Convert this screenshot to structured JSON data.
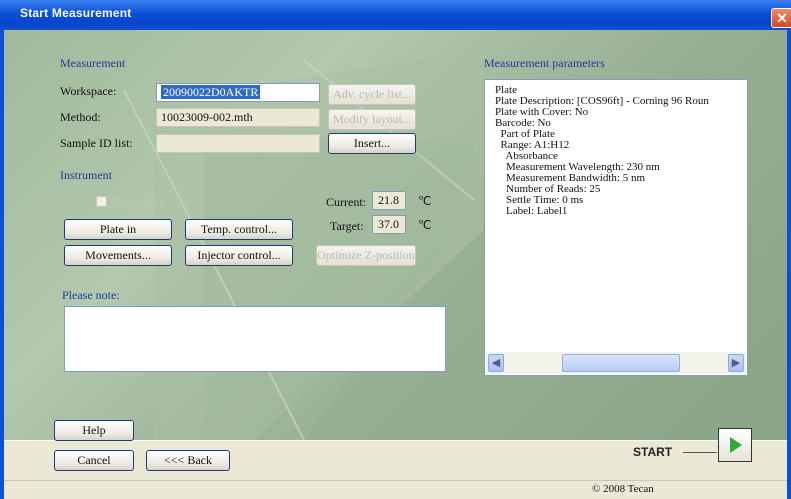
{
  "window": {
    "title": "Start Measurement",
    "close_glyph": "✕"
  },
  "measurement": {
    "group_label": "Measurement",
    "workspace_label": "Workspace:",
    "workspace_value": "20090022D0AKTR",
    "method_label": "Method:",
    "method_value": "10023009-002.mth",
    "sample_id_label": "Sample ID list:",
    "sample_id_value": "",
    "adv_cycle_button": "Adv. cycle list...",
    "modify_layout_button": "Modify layout...",
    "insert_button": "Insert..."
  },
  "instrument": {
    "group_label": "Instrument",
    "use_reader_label": "Use reader",
    "current_label": "Current:",
    "current_value": "21.8",
    "target_label": "Target:",
    "target_value": "37.0",
    "temp_unit": "℃",
    "plate_in_button": "Plate in",
    "temp_control_button": "Temp. control...",
    "movements_button": "Movements...",
    "injector_control_button": "Injector control...",
    "optimize_z_button": "Optimize Z-position..."
  },
  "note": {
    "label": "Please note:",
    "value": ""
  },
  "parameters": {
    "group_label": "Measurement parameters",
    "lines": [
      "Plate",
      "Plate Description: [COS96ft] - Corning 96 Roun",
      "Plate with Cover: No",
      "Barcode: No",
      "  Part of Plate",
      "  Range: A1:H12",
      "    Absorbance",
      "    Measurement Wavelength: 230 nm",
      "    Measurement Bandwidth: 5 nm",
      "    Number of Reads: 25",
      "    Settle Time: 0 ms",
      "    Label: Label1"
    ]
  },
  "footer": {
    "help_button": "Help",
    "cancel_button": "Cancel",
    "back_button": "<<< Back",
    "start_label": "START",
    "copyright": "© 2008 Tecan"
  },
  "icons": {
    "play": "play-icon",
    "scroll_left": "◀",
    "scroll_right": "▶",
    "close": "close-icon"
  },
  "colors": {
    "title_bar": "#0a4fd8",
    "group_label": "#1e3ca0",
    "play_green": "#2fa83a",
    "selection": "#316ac5"
  }
}
